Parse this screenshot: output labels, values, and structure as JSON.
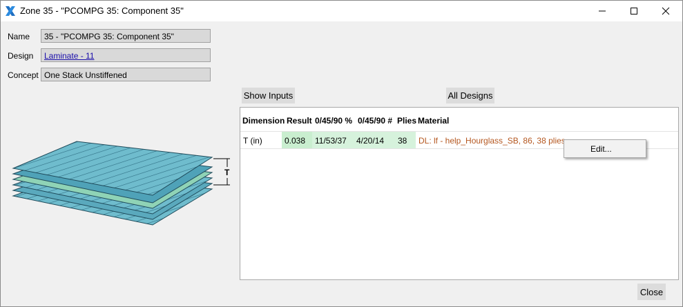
{
  "window": {
    "title": "Zone 35 - \"PCOMPG 35: Component 35\"",
    "controls": [
      "minimize",
      "maximize",
      "close"
    ]
  },
  "fields": {
    "name_label": "Name",
    "name_value": "35 - \"PCOMPG 35: Component 35\"",
    "design_label": "Design",
    "design_value": "Laminate - 11",
    "concept_label": "Concept",
    "concept_value": "One Stack Unstiffened"
  },
  "buttons": {
    "show_inputs": "Show Inputs",
    "all_designs": "All Designs",
    "close": "Close"
  },
  "illustration": {
    "thickness_label": "T",
    "colors": {
      "ply_fill": "#5fb4c8",
      "ply_top": "#7cc7d6",
      "ply_stripe": "#3d7f94",
      "accent_ply": "#8fd3b6"
    }
  },
  "table": {
    "columns": [
      "Dimension",
      "Result",
      "0/45/90 %",
      "0/45/90 #",
      "Plies",
      "Material"
    ],
    "rows": [
      {
        "dimension": "T (in)",
        "result": "0.038",
        "pct": "11/53/37",
        "count": "4/20/14",
        "plies": "38",
        "material": "DL: lf - help_Hourglass_SB, 86, 38 plies"
      }
    ],
    "colors": {
      "result_bg": "#c9eecf",
      "material_text": "#b4561e"
    }
  },
  "context_menu": {
    "items": [
      "Edit..."
    ]
  }
}
